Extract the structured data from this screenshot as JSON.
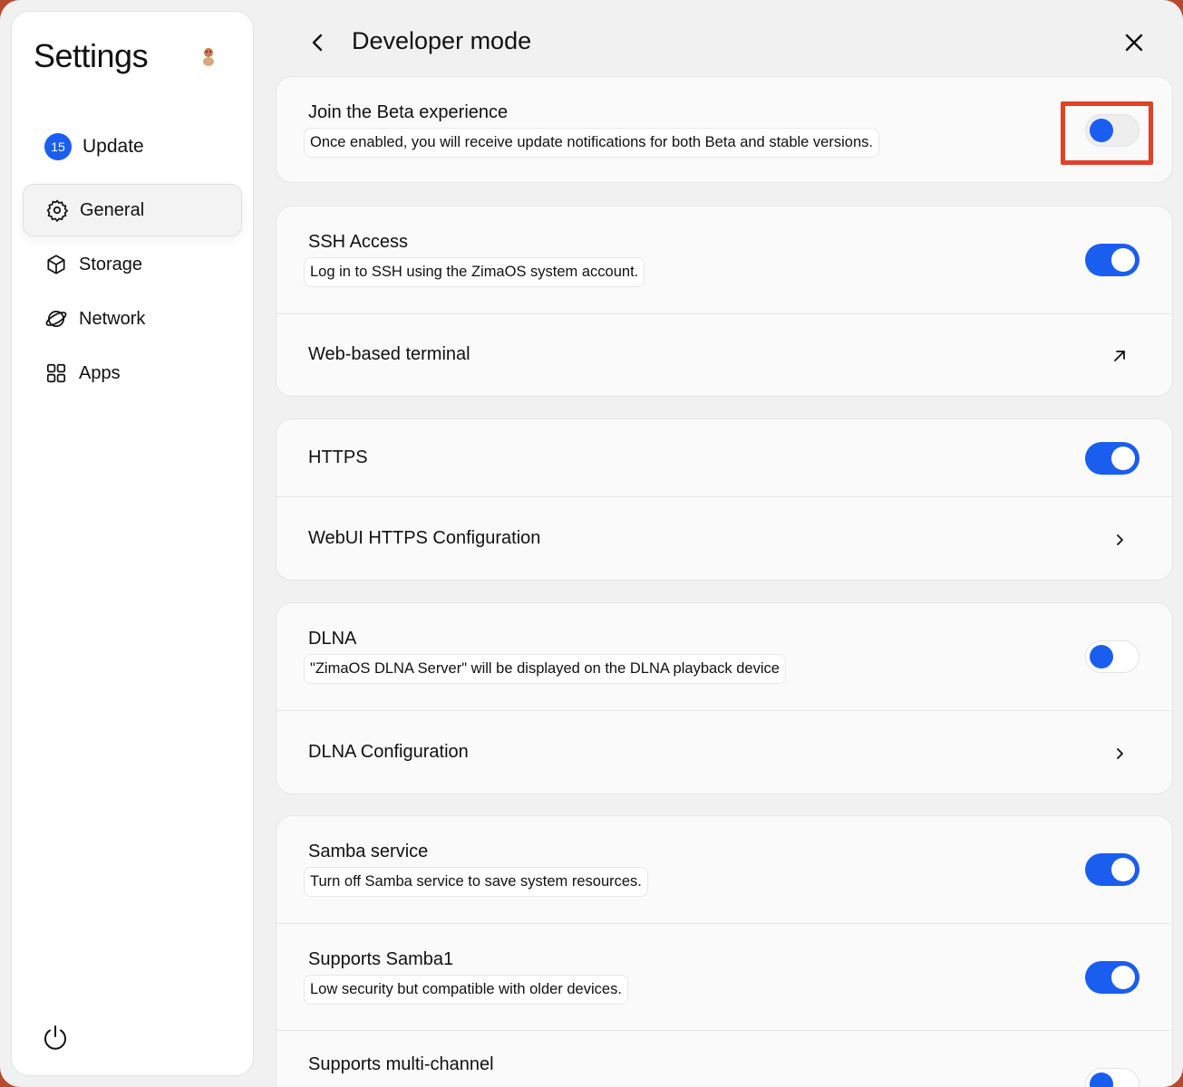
{
  "sidebar": {
    "title": "Settings",
    "update": {
      "badge": "15",
      "label": "Update"
    },
    "items": [
      {
        "label": "General",
        "icon": "gear-icon",
        "active": true
      },
      {
        "label": "Storage",
        "icon": "cube-icon"
      },
      {
        "label": "Network",
        "icon": "globe-icon"
      },
      {
        "label": "Apps",
        "icon": "grid-icon"
      }
    ]
  },
  "header": {
    "title": "Developer mode"
  },
  "sections": {
    "beta": {
      "title": "Join the Beta experience",
      "desc": "Once enabled, you will receive update notifications for both Beta and stable versions.",
      "enabled": false
    },
    "ssh": {
      "title": "SSH Access",
      "desc": "Log in to SSH using the ZimaOS system account.",
      "enabled": true
    },
    "terminal": {
      "title": "Web-based terminal"
    },
    "https": {
      "title": "HTTPS",
      "enabled": true
    },
    "webui_https": {
      "title": "WebUI HTTPS Configuration"
    },
    "dlna": {
      "title": "DLNA",
      "desc": "\"ZimaOS DLNA Server\" will be displayed on the DLNA playback device",
      "enabled": false
    },
    "dlna_config": {
      "title": "DLNA Configuration"
    },
    "samba": {
      "title": "Samba service",
      "desc": "Turn off Samba service to save system resources.",
      "enabled": true
    },
    "samba1": {
      "title": "Supports Samba1",
      "desc": "Low security but compatible with older devices.",
      "enabled": true
    },
    "multichannel": {
      "title": "Supports multi-channel"
    }
  },
  "colors": {
    "accent": "#1a5ef0",
    "highlight": "#e0412a",
    "background": "#f1f1f1"
  }
}
